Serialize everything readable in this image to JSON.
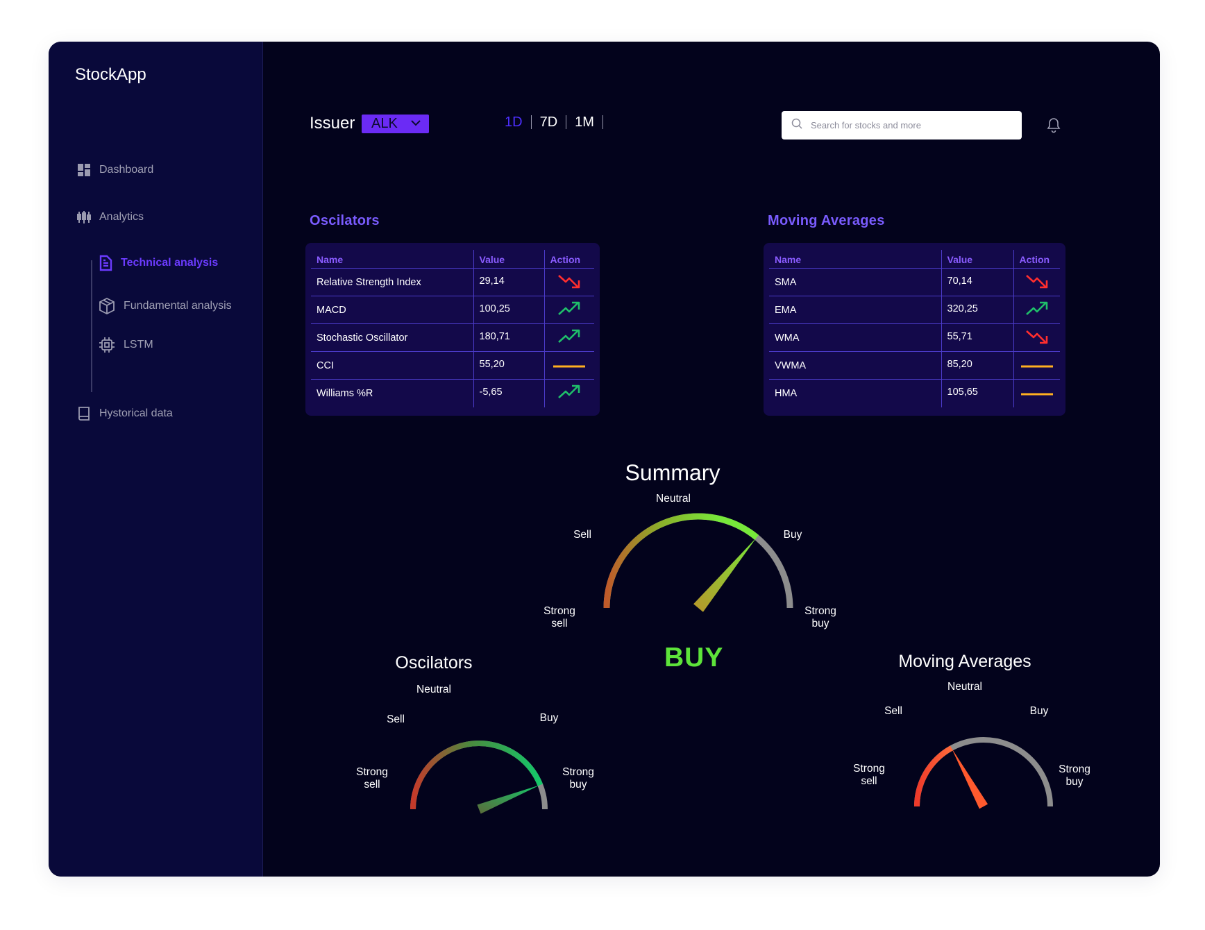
{
  "app": {
    "name": "StockApp"
  },
  "sidebar": {
    "items": [
      {
        "label": "Dashboard",
        "icon": "dashboard-icon"
      },
      {
        "label": "Analytics",
        "icon": "candlestick-icon"
      },
      {
        "label": "Technical analysis",
        "icon": "document-icon",
        "active": true
      },
      {
        "label": "Fundamental analysis",
        "icon": "cube-icon"
      },
      {
        "label": "LSTM",
        "icon": "chip-icon"
      },
      {
        "label": "Hystorical data",
        "icon": "book-icon"
      }
    ]
  },
  "topbar": {
    "issuer_label": "Issuer",
    "issuer_value": "ALK",
    "periods": [
      "1D",
      "7D",
      "1M"
    ],
    "active_period": "1D",
    "search_placeholder": "Search for stocks and more"
  },
  "oscillators": {
    "title": "Oscilators",
    "headers": [
      "Name",
      "Value",
      "Action"
    ],
    "rows": [
      {
        "name": "Relative Strength Index",
        "value": "29,14",
        "action": "down"
      },
      {
        "name": "MACD",
        "value": "100,25",
        "action": "up"
      },
      {
        "name": "Stochastic Oscillator",
        "value": "180,71",
        "action": "up"
      },
      {
        "name": "CCI",
        "value": "55,20",
        "action": "neutral"
      },
      {
        "name": "Williams %R",
        "value": "-5,65",
        "action": "up"
      }
    ]
  },
  "moving_averages": {
    "title": "Moving Averages",
    "headers": [
      "Name",
      "Value",
      "Action"
    ],
    "rows": [
      {
        "name": "SMA",
        "value": "70,14",
        "action": "down"
      },
      {
        "name": "EMA",
        "value": "320,25",
        "action": "up"
      },
      {
        "name": "WMA",
        "value": "55,71",
        "action": "down"
      },
      {
        "name": "VWMA",
        "value": "85,20",
        "action": "neutral"
      },
      {
        "name": "HMA",
        "value": "105,65",
        "action": "neutral"
      }
    ]
  },
  "gauges": {
    "labels": {
      "neutral": "Neutral",
      "sell": "Sell",
      "buy": "Buy",
      "strong_sell": "Strong sell",
      "strong_buy": "Strong buy"
    },
    "summary": {
      "title": "Summary",
      "verdict": "BUY",
      "level": 0.72
    },
    "oscillators": {
      "title": "Oscilators",
      "level": 0.88
    },
    "moving_averages": {
      "title": "Moving Averages",
      "level": 0.34
    }
  },
  "colors": {
    "accent": "#6b2bf5",
    "up": "#1fbf6a",
    "down": "#ff2e2e",
    "neutral": "#ffb020",
    "verdict": "#5de33a"
  }
}
